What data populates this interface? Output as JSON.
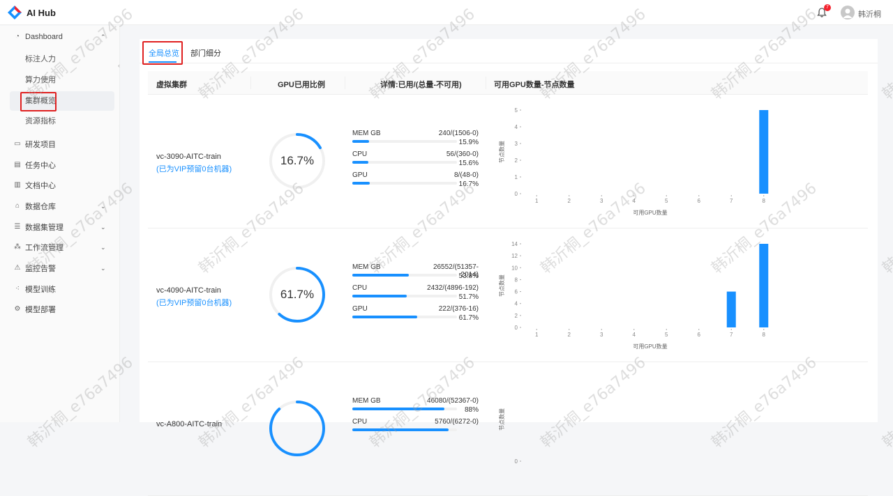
{
  "app": {
    "title": "AI Hub"
  },
  "header": {
    "notification_count": "7",
    "user_name": "韩沂桐"
  },
  "sidebar": {
    "dashboard_label": "Dashboard",
    "sub_items": [
      "标注人力",
      "算力使用",
      "集群概览",
      "资源指标"
    ],
    "active_sub_item": "集群概览",
    "items": [
      {
        "label": "研发项目",
        "icon": "folder-icon",
        "expandable": false
      },
      {
        "label": "任务中心",
        "icon": "clipboard-icon",
        "expandable": false
      },
      {
        "label": "文档中心",
        "icon": "document-icon",
        "expandable": false
      },
      {
        "label": "数据仓库",
        "icon": "warehouse-icon",
        "expandable": true
      },
      {
        "label": "数据集管理",
        "icon": "database-icon",
        "expandable": true
      },
      {
        "label": "工作流管理",
        "icon": "workflow-icon",
        "expandable": true
      },
      {
        "label": "监控告警",
        "icon": "alert-icon",
        "expandable": true
      },
      {
        "label": "模型训练",
        "icon": "model-train-icon",
        "expandable": false
      },
      {
        "label": "模型部署",
        "icon": "model-deploy-icon",
        "expandable": false
      }
    ]
  },
  "tabs": {
    "active": "全局总览",
    "other": "部门细分"
  },
  "table": {
    "headers": [
      "虚拟集群",
      "GPU已用比例",
      "详情:已用/(总量-不可用)",
      "可用GPU数量-节点数量"
    ]
  },
  "clusters": [
    {
      "name": "vc-3090-AITC-train",
      "vip_note": "(已为VIP预留0台机器)",
      "gpu_ratio_label": "16.7%",
      "gpu_ratio": 0.167,
      "metrics": [
        {
          "name": "MEM GB",
          "value": "240/(1506-0)",
          "pct_label": "15.9%",
          "pct": 0.159
        },
        {
          "name": "CPU",
          "value": "56/(360-0)",
          "pct_label": "15.6%",
          "pct": 0.156
        },
        {
          "name": "GPU",
          "value": "8/(48-0)",
          "pct_label": "16.7%",
          "pct": 0.167
        }
      ]
    },
    {
      "name": "vc-4090-AITC-train",
      "vip_note": "(已为VIP预留0台机器)",
      "gpu_ratio_label": "61.7%",
      "gpu_ratio": 0.617,
      "metrics": [
        {
          "name": "MEM GB",
          "value": "26552/(51357-2014)",
          "pct_label": "53.8%",
          "pct": 0.538
        },
        {
          "name": "CPU",
          "value": "2432/(4896-192)",
          "pct_label": "51.7%",
          "pct": 0.517
        },
        {
          "name": "GPU",
          "value": "222/(376-16)",
          "pct_label": "61.7%",
          "pct": 0.617
        }
      ]
    },
    {
      "name": "vc-A800-AITC-train",
      "vip_note": "",
      "gpu_ratio_label": "",
      "gpu_ratio": 0.88,
      "metrics": [
        {
          "name": "MEM GB",
          "value": "46080/(52367-0)",
          "pct_label": "88%",
          "pct": 0.88
        },
        {
          "name": "CPU",
          "value": "5760/(6272-0)",
          "pct_label": "",
          "pct": 0.92
        }
      ]
    }
  ],
  "chart_data": [
    {
      "type": "bar",
      "xlabel": "可用GPU数量",
      "ylabel": "节点数量",
      "categories": [
        "1",
        "2",
        "3",
        "4",
        "5",
        "6",
        "7",
        "8"
      ],
      "values": [
        0,
        0,
        0,
        0,
        0,
        0,
        0,
        5
      ],
      "yticks": [
        0,
        1,
        2,
        3,
        4,
        5
      ],
      "ylim": [
        0,
        5
      ],
      "color": "#1890ff"
    },
    {
      "type": "bar",
      "xlabel": "可用GPU数量",
      "ylabel": "节点数量",
      "categories": [
        "1",
        "2",
        "3",
        "4",
        "5",
        "6",
        "7",
        "8"
      ],
      "values": [
        0,
        0,
        0,
        0,
        0,
        0,
        6,
        14
      ],
      "yticks": [
        0,
        2,
        4,
        6,
        8,
        10,
        12,
        14
      ],
      "ylim": [
        0,
        14
      ],
      "color": "#1890ff"
    },
    {
      "type": "bar",
      "xlabel": "",
      "ylabel": "节点数量",
      "categories": [],
      "values": [],
      "yticks": [
        0
      ],
      "ylim": [
        0,
        1
      ],
      "color": "#1890ff"
    }
  ],
  "watermark": "韩沂桐_e76a7496",
  "colors": {
    "accent": "#1890ff",
    "highlight": "#e02020"
  }
}
